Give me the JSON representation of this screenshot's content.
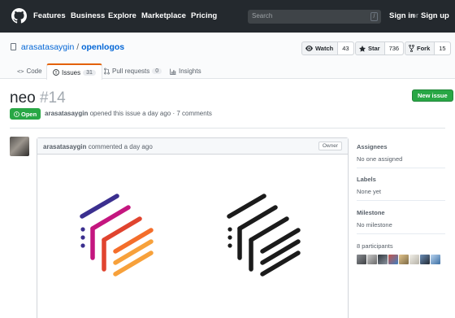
{
  "nav": {
    "links": [
      "Features",
      "Business",
      "Explore",
      "Marketplace",
      "Pricing"
    ],
    "search_placeholder": "Search",
    "search_key": "/",
    "sign_in": "Sign in",
    "or": "or",
    "sign_up": "Sign up"
  },
  "repo": {
    "owner": "arasatasaygin",
    "separator": "/",
    "name": "openlogos",
    "watch": {
      "label": "Watch",
      "count": "43"
    },
    "star": {
      "label": "Star",
      "count": "736"
    },
    "fork": {
      "label": "Fork",
      "count": "15"
    }
  },
  "tabs": [
    {
      "label": "Code",
      "icon": "code-icon"
    },
    {
      "label": "Issues",
      "count": "31",
      "icon": "issue-icon"
    },
    {
      "label": "Pull requests",
      "count": "0",
      "icon": "pull-request-icon"
    },
    {
      "label": "Insights",
      "icon": "graph-icon"
    }
  ],
  "issue": {
    "title": "neo",
    "number": "#14",
    "new_issue": "New issue",
    "state": "Open",
    "author": "arasatasaygin",
    "opened_text": "opened this issue a day ago · 7 comments"
  },
  "comment": {
    "author": "arasatasaygin",
    "time": "commented a day ago",
    "role": "Owner"
  },
  "sidebar": {
    "assignees_label": "Assignees",
    "assignees_value": "No one assigned",
    "labels_label": "Labels",
    "labels_value": "None yet",
    "milestone_label": "Milestone",
    "milestone_value": "No milestone",
    "participants_label": "8 participants"
  },
  "colors": {
    "nav_bg": "#24292e",
    "link": "#0366d6",
    "green": "#28a745",
    "tab_accent": "#e36209",
    "logo_bars": [
      "#3b2f8f",
      "#c4167f",
      "#e0442f",
      "#f46e2b",
      "#f7a13b"
    ],
    "logo_mono": "#1b1b1b"
  }
}
